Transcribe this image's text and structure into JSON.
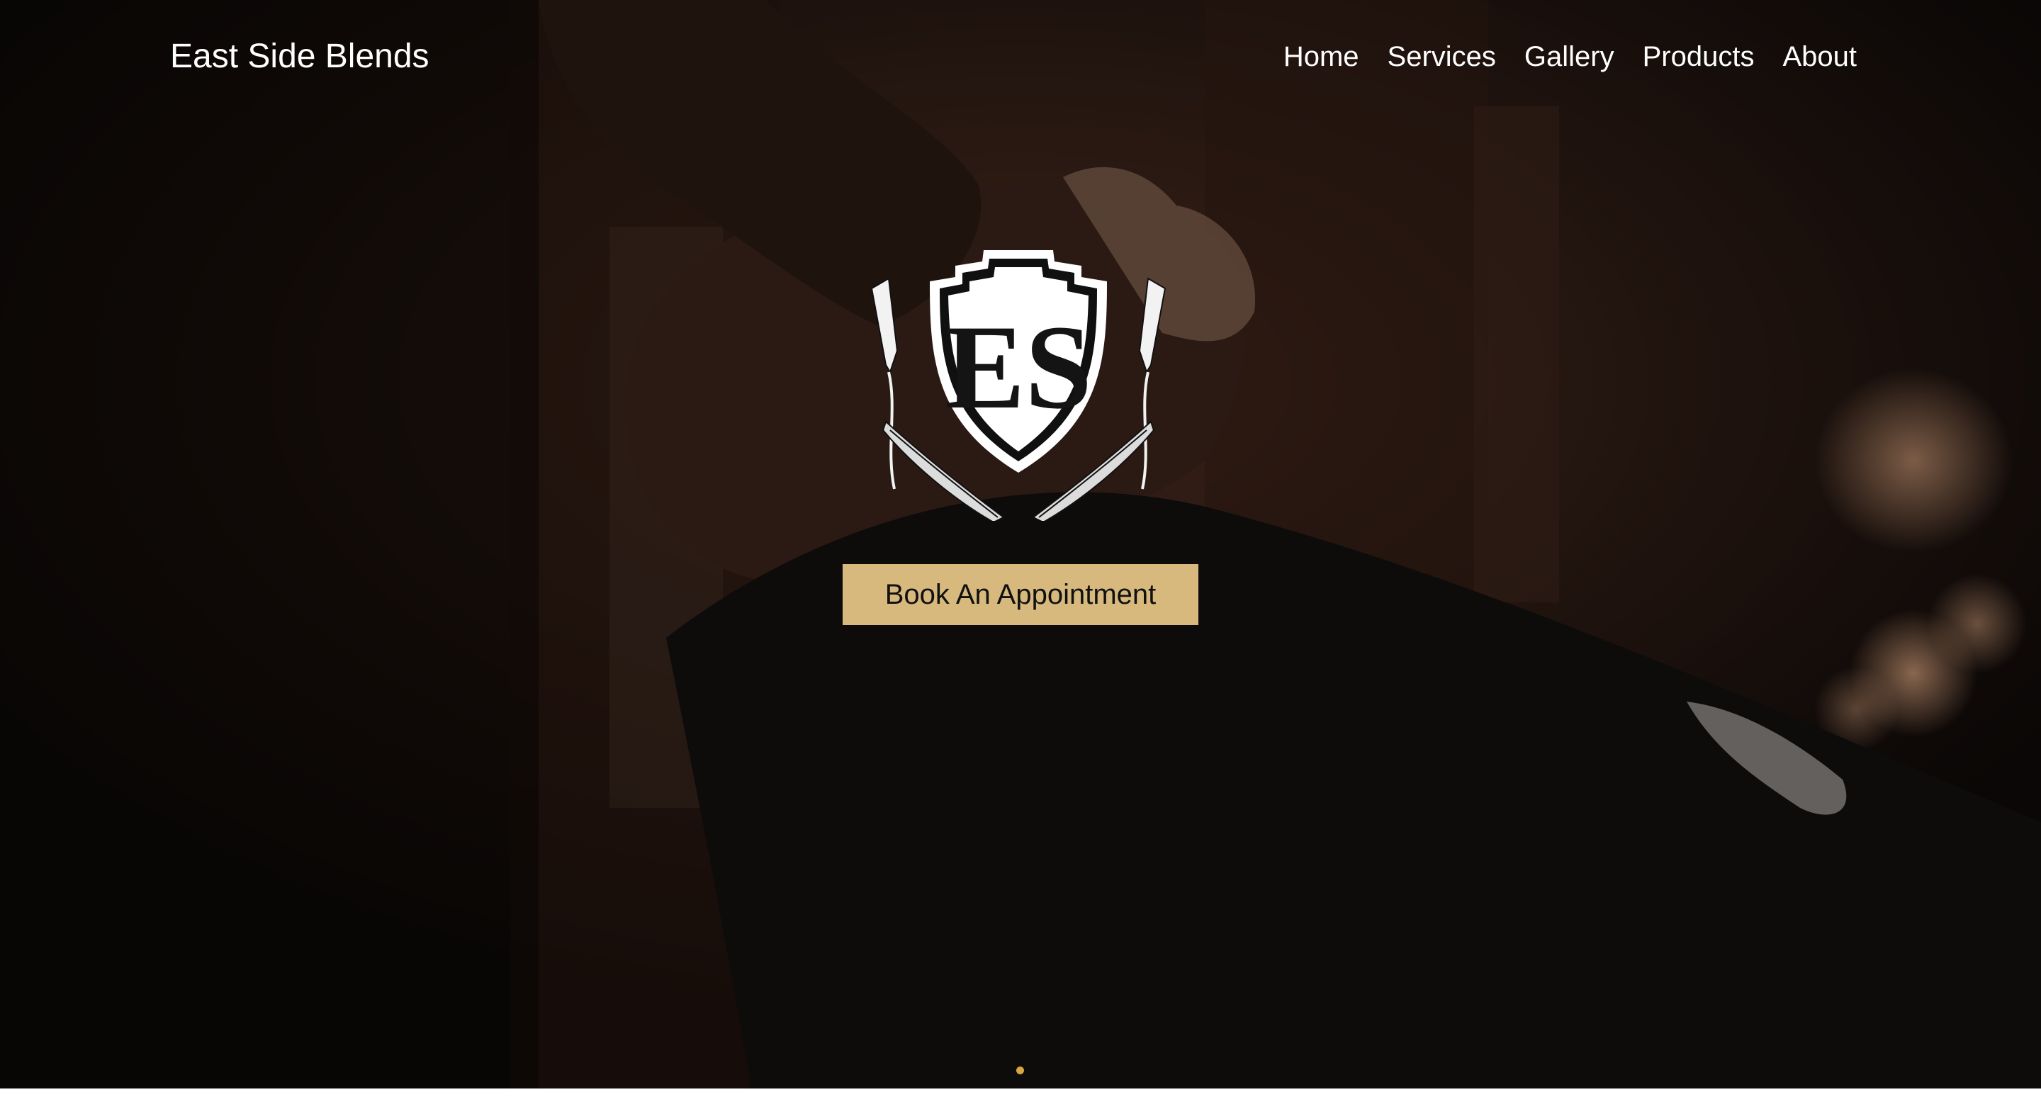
{
  "header": {
    "brand": "East Side Blends",
    "nav": [
      {
        "label": "Home"
      },
      {
        "label": "Services"
      },
      {
        "label": "Gallery"
      },
      {
        "label": "Products"
      },
      {
        "label": "About"
      }
    ]
  },
  "hero": {
    "logo_icon": "east-side-crest-with-razors",
    "logo_text": "ES",
    "cta_label": "Book An Appointment",
    "slider": {
      "active_index": 1,
      "count": 1
    }
  },
  "colors": {
    "accent": "#d7b97d",
    "dot": "#d9a640",
    "text": "#ffffff",
    "background": "#0b0807"
  }
}
